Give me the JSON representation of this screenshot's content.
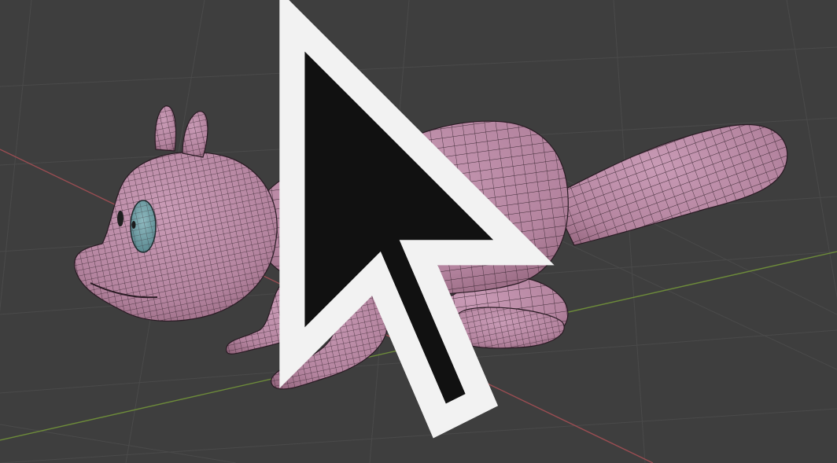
{
  "viewport": {
    "kind": "3d-viewport",
    "background_color": "#3e3e3e",
    "grid_color": "#4a4a4a",
    "x_axis_color": "#9a4d52",
    "y_axis_color": "#6d8b3a"
  },
  "model": {
    "subject": "squirrel",
    "shading": "solid",
    "overlay": "wireframe",
    "body_color": "#b98aa6",
    "wire_color": "#2a1b24",
    "eye_color": "#7eaab0"
  },
  "icons": {
    "origin": "3d-cursor-icon",
    "pointer": "mouse-pointer-icon"
  }
}
